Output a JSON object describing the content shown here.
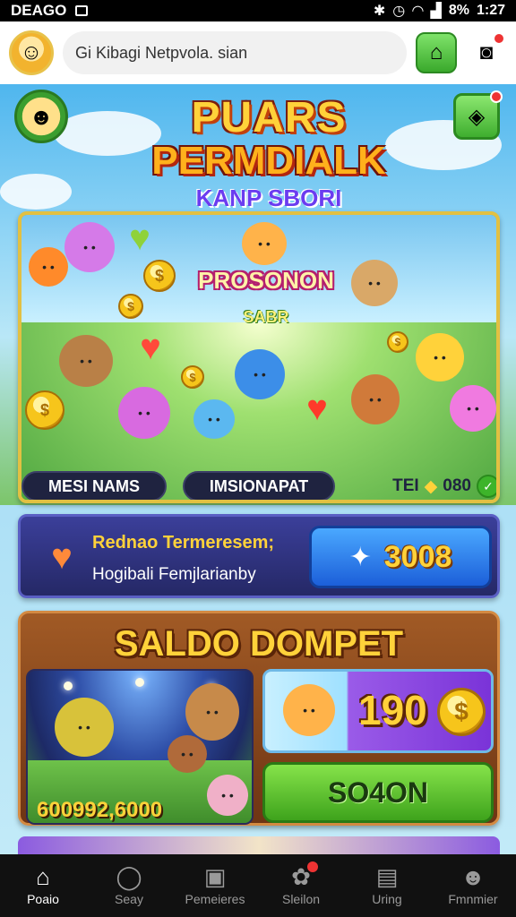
{
  "status_bar": {
    "carrier": "DEAGO",
    "battery": "8%",
    "time": "1:27"
  },
  "top_bar": {
    "search_text": "Gi Kibagi Netpvola. sian"
  },
  "hero": {
    "logo_line1": "PUARS",
    "logo_line2": "PERMDIALK",
    "logo_line3": "KANP SBORI"
  },
  "game_panel": {
    "title": "PROSONON",
    "subtitle": "SABR",
    "chip_left": "MESI NAMS",
    "chip_middle": "IMSIONAPAT",
    "score_label": "TEI",
    "score_value": "080"
  },
  "reward": {
    "title": "Rednao Termeresem;",
    "subtitle": "Hogibali Femjlarianby",
    "button_value": "3008"
  },
  "wallet": {
    "title": "SALDO DOMPET",
    "arena_amount": "600992,6000",
    "balance_value": "190",
    "action_label": "SO4ON"
  },
  "bottom_nav": [
    {
      "label": "Poaio",
      "icon": "home-icon",
      "active": true
    },
    {
      "label": "Seay",
      "icon": "chat-icon",
      "active": false
    },
    {
      "label": "Pemeieres",
      "icon": "gallery-icon",
      "active": false
    },
    {
      "label": "Sleilon",
      "icon": "bell-icon",
      "active": false
    },
    {
      "label": "Uring",
      "icon": "clipboard-icon",
      "active": false
    },
    {
      "label": "Fmnmier",
      "icon": "people-icon",
      "active": false
    }
  ],
  "colors": {
    "accent_gold": "#ffd23a",
    "nav_bg": "#111111",
    "action_green": "#3ea31c",
    "reward_blue": "#1c5fd9"
  }
}
